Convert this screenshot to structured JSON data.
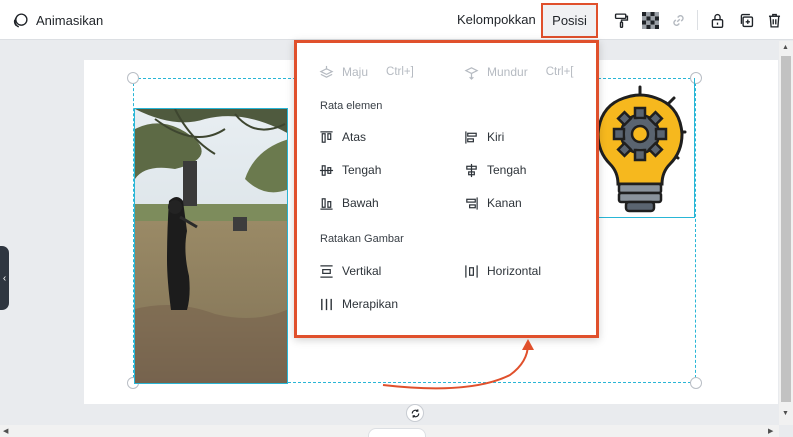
{
  "toolbar": {
    "animate_label": "Animasikan",
    "group_label": "Kelompokkan",
    "position_label": "Posisi"
  },
  "menu": {
    "forward": {
      "label": "Maju",
      "shortcut": "Ctrl+]"
    },
    "backward": {
      "label": "Mundur",
      "shortcut": "Ctrl+["
    },
    "align_section": "Rata elemen",
    "align_items": [
      {
        "label": "Atas",
        "icon": "align-top-icon"
      },
      {
        "label": "Kiri",
        "icon": "align-left-icon"
      },
      {
        "label": "Tengah",
        "icon": "align-middle-icon"
      },
      {
        "label": "Tengah",
        "icon": "align-center-icon"
      },
      {
        "label": "Bawah",
        "icon": "align-bottom-icon"
      },
      {
        "label": "Kanan",
        "icon": "align-right-icon"
      }
    ],
    "distribute_section": "Ratakan Gambar",
    "distribute_items": [
      {
        "label": "Vertikal",
        "icon": "distribute-vertical-icon"
      },
      {
        "label": "Horizontal",
        "icon": "distribute-horizontal-icon"
      },
      {
        "label": "Merapikan",
        "icon": "tidy-up-icon"
      }
    ]
  },
  "colors": {
    "accent_annotation": "#e0502c",
    "selection": "#29b6d6",
    "bulb": "#f6b81e"
  },
  "icons": [
    "paint-format-icon",
    "transparency-icon",
    "link-icon",
    "lock-icon",
    "duplicate-icon",
    "trash-icon",
    "rotate-icon"
  ]
}
